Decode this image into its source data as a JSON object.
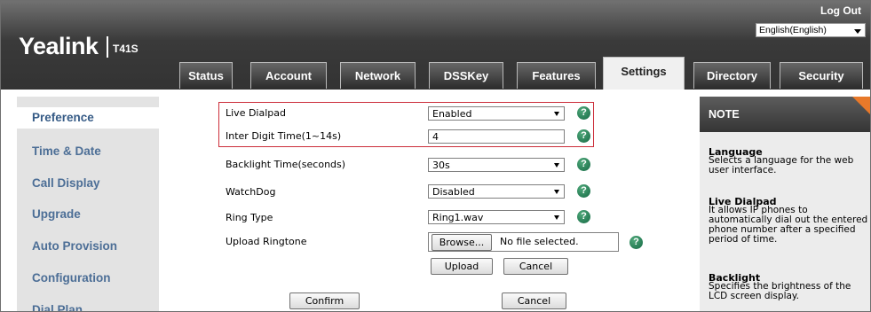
{
  "header": {
    "logo": "Yealink",
    "model": "T41S",
    "logout": "Log Out",
    "language": "English(English)"
  },
  "tabs": [
    "Status",
    "Account",
    "Network",
    "DSSKey",
    "Features",
    "Settings",
    "Directory",
    "Security"
  ],
  "active_tab": "Settings",
  "sidebar": {
    "items": [
      "Preference",
      "Time & Date",
      "Call Display",
      "Upgrade",
      "Auto Provision",
      "Configuration",
      "Dial Plan"
    ],
    "active": "Preference"
  },
  "form": {
    "live_dialpad": {
      "label": "Live Dialpad",
      "value": "Enabled"
    },
    "inter_digit": {
      "label": "Inter Digit Time(1~14s)",
      "value": "4"
    },
    "backlight": {
      "label": "Backlight Time(seconds)",
      "value": "30s"
    },
    "watchdog": {
      "label": "WatchDog",
      "value": "Disabled"
    },
    "ring_type": {
      "label": "Ring Type",
      "value": "Ring1.wav"
    },
    "upload_ringtone": {
      "label": "Upload Ringtone",
      "browse": "Browse...",
      "file_status": "No file selected."
    },
    "upload_button": "Upload",
    "upload_cancel": "Cancel",
    "confirm": "Confirm",
    "cancel": "Cancel"
  },
  "note": {
    "header": "NOTE",
    "sections": [
      {
        "title": "Language",
        "text": "Selects a language for the web user interface."
      },
      {
        "title": "Live Dialpad",
        "text": "It allows IP phones to automatically dial out the entered phone number after a specified period of time."
      },
      {
        "title": "Backlight",
        "text": "Specifies the brightness of the LCD screen display."
      }
    ]
  },
  "colors": {
    "header_dark": "#333333",
    "nav_text": "#4c6e96",
    "help_green": "#1f7a52",
    "highlight_red": "#cc2e3a",
    "note_accent": "#e8792a"
  }
}
